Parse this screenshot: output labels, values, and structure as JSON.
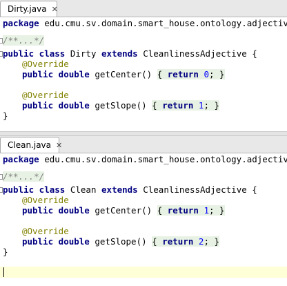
{
  "editors": [
    {
      "tab": "Dirty.java",
      "package_kw": "package",
      "package_name": "edu.cmu.sv.domain.smart_house.ontology.adjective;",
      "doc_comment": "/**...*/",
      "class_line": {
        "mods": "public class",
        "name": "Dirty",
        "extends_kw": "extends",
        "super": "CleanlinessAdjective {"
      },
      "methods": [
        {
          "annotation": "@Override",
          "mods": "public double",
          "name": "getCenter()",
          "body_kw": "return",
          "value": "0",
          "end": ";"
        },
        {
          "annotation": "@Override",
          "mods": "public double",
          "name": "getSlope()",
          "body_kw": "return",
          "value": "1",
          "end": ";"
        }
      ],
      "close": "}"
    },
    {
      "tab": "Clean.java",
      "package_kw": "package",
      "package_name": "edu.cmu.sv.domain.smart_house.ontology.adjective;",
      "doc_comment": "/**...*/",
      "class_line": {
        "mods": "public class",
        "name": "Clean",
        "extends_kw": "extends",
        "super": "CleanlinessAdjective {"
      },
      "methods": [
        {
          "annotation": "@Override",
          "mods": "public double",
          "name": "getCenter()",
          "body_kw": "return",
          "value": "1",
          "end": ";"
        },
        {
          "annotation": "@Override",
          "mods": "public double",
          "name": "getSlope()",
          "body_kw": "return",
          "value": "2",
          "end": ";"
        }
      ],
      "close": "}"
    }
  ],
  "close_icon": "close-x-icon"
}
